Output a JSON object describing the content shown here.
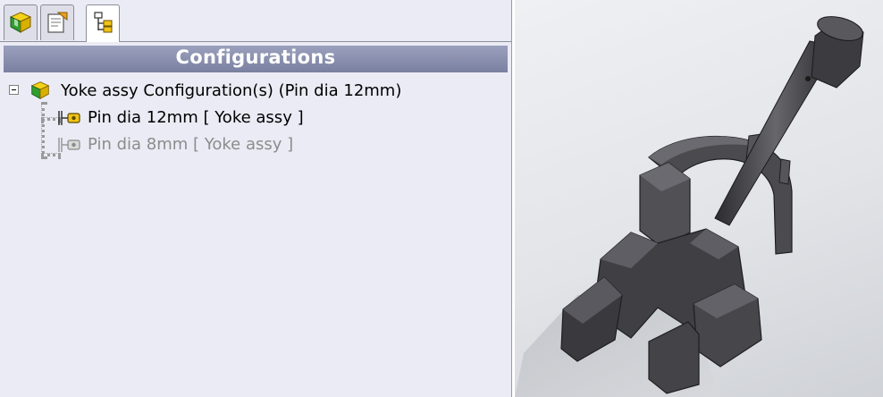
{
  "panel": {
    "title": "Configurations",
    "tabs": [
      {
        "name": "FeatureManager design tree",
        "icon": "assembly-icon"
      },
      {
        "name": "PropertyManager",
        "icon": "property-manager-icon"
      },
      {
        "name": "ConfigurationManager",
        "icon": "configuration-manager-icon",
        "active": true
      }
    ]
  },
  "tree": {
    "root": {
      "label": "Yoke assy Configuration(s)  (Pin dia 12mm)",
      "icon": "assembly-icon",
      "expanded": true
    },
    "configs": [
      {
        "label": "Pin dia 12mm [ Yoke assy ]",
        "icon": "configuration-icon",
        "active": true
      },
      {
        "label": "Pin dia 8mm [ Yoke assy ]",
        "icon": "configuration-icon",
        "active": false
      }
    ]
  },
  "colors": {
    "panel_bg": "#ebebf5",
    "header_bg": "#8a90ae",
    "active_text": "#000000",
    "inactive_text": "#8c8c8c",
    "model": "#3c3c40"
  },
  "viewport": {
    "model": "Yoke assy 3D model",
    "icon": "3d-model-view"
  }
}
